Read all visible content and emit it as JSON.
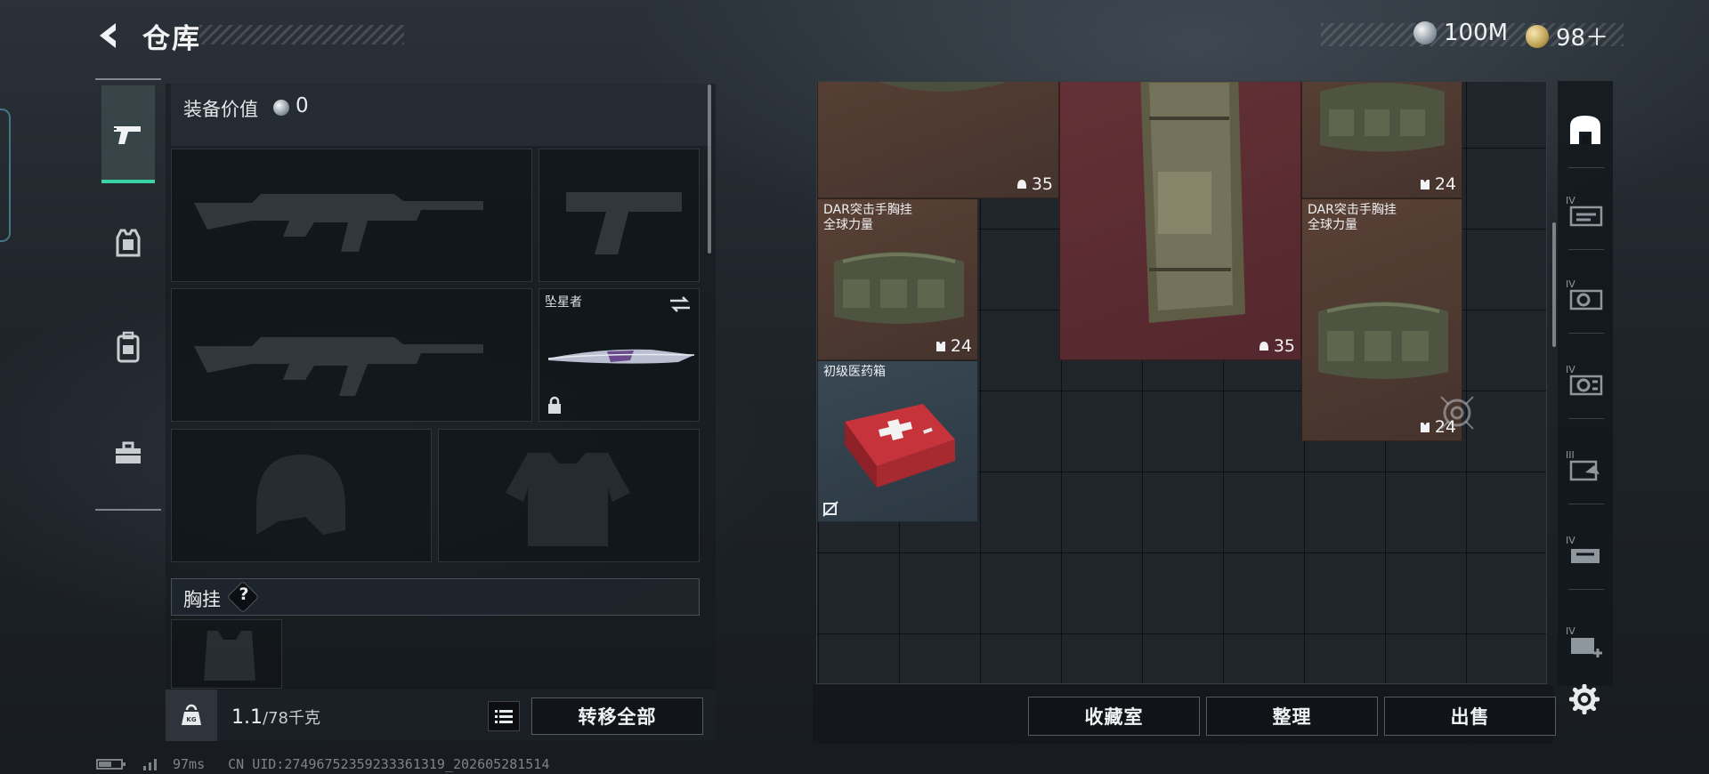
{
  "header": {
    "title": "仓库",
    "currency": [
      {
        "icon": "silver-coin-icon",
        "value": "100M"
      },
      {
        "icon": "gold-coin-icon",
        "value": "98＋"
      }
    ]
  },
  "left_tabs": [
    {
      "icon": "pistol-icon",
      "active": true
    },
    {
      "icon": "body-armor-icon",
      "active": false
    },
    {
      "icon": "backpack-icon",
      "active": false
    },
    {
      "icon": "toolbox-icon",
      "active": false
    }
  ],
  "equipment": {
    "value_label": "装备价值",
    "value": "0",
    "melee_slot": {
      "name": "坠星者"
    },
    "chest_rig_label": "胸挂",
    "chest_rig_help": "?",
    "weight_current": "1.1",
    "weight_max": "/78千克",
    "weight_icon_text": "KG",
    "transfer_all_label": "转移全部"
  },
  "stash_items": [
    {
      "name": "",
      "badge": "35",
      "badge_icon": "helmet-icon",
      "color": "brown"
    },
    {
      "name": "",
      "badge": "35",
      "badge_icon": "helmet-icon",
      "color": "maroon"
    },
    {
      "name": "",
      "badge": "24",
      "badge_icon": "armor-vest-icon",
      "color": "brown"
    },
    {
      "name": "DAR突击手胸挂\n全球力量",
      "badge": "24",
      "badge_icon": "armor-vest-icon",
      "color": "brown"
    },
    {
      "name": "DAR突击手胸挂\n全球力量",
      "badge": "24",
      "badge_icon": "armor-vest-icon",
      "color": "brown"
    },
    {
      "name": "初级医药箱",
      "badge": "",
      "badge_icon": "no-trade-icon",
      "color": "blue"
    }
  ],
  "right_tabs": [
    {
      "icon": "stash-home-icon",
      "active": true
    },
    {
      "icon": "stash-weapons-icon",
      "active": false
    },
    {
      "icon": "stash-ammo-icon",
      "active": false
    },
    {
      "icon": "stash-gear-icon",
      "active": false
    },
    {
      "icon": "stash-medical-icon",
      "active": false
    },
    {
      "icon": "stash-misc-icon",
      "active": false
    },
    {
      "icon": "stash-add-icon",
      "active": false
    }
  ],
  "actions": {
    "collection_label": "收藏室",
    "sort_label": "整理",
    "sell_label": "出售"
  },
  "status": {
    "ping": "97ms",
    "uid": "CN UID:27496752359233361319_202605281514"
  },
  "colors": {
    "accent": "#39d1a6",
    "rarity_brown": "#5c4236",
    "rarity_maroon": "#683238",
    "rarity_blue": "#3a4a56"
  }
}
